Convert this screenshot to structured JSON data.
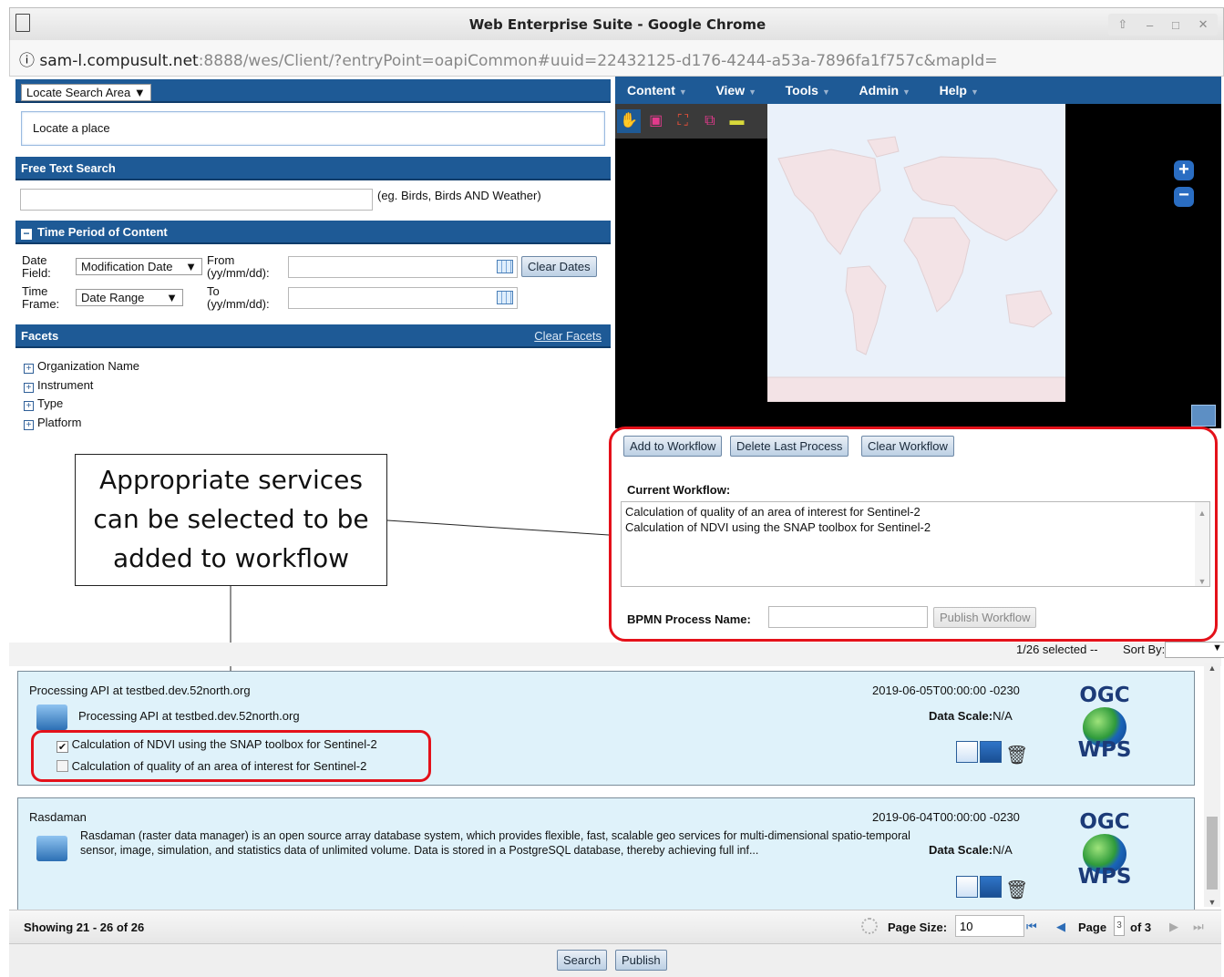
{
  "window": {
    "title": "Web Enterprise Suite - Google Chrome",
    "controls": [
      "⇧",
      "–",
      "□",
      "✕"
    ]
  },
  "address_bar": {
    "info_icon": "ⓘ",
    "host": "sam-l.compusult.net",
    "rest": ":8888/wes/Client/?entryPoint=oapiCommon#uuid=22432125-d176-4244-a53a-7896fa1f757c&mapId="
  },
  "left_panel": {
    "locate_dropdown": "Locate Search Area",
    "locate_placeholder": "Locate a place",
    "free_text_header": "Free Text Search",
    "free_text_hint": "(eg. Birds, Birds AND Weather)",
    "time_header": "Time Period of Content",
    "date_field_label": "Date Field:",
    "date_field_value": "Modification Date",
    "from_label": "From (yy/mm/dd):",
    "clear_dates": "Clear Dates",
    "time_frame_label": "Time Frame:",
    "time_frame_value": "Date Range",
    "to_label": "To (yy/mm/dd):",
    "facets_header": "Facets",
    "clear_facets": "Clear Facets",
    "facets": [
      "Organization Name",
      "Instrument",
      "Type",
      "Platform"
    ]
  },
  "map_menu": [
    "Content",
    "View",
    "Tools",
    "Admin",
    "Help"
  ],
  "workflow": {
    "add": "Add to Workflow",
    "delete_last": "Delete Last Process",
    "clear": "Clear Workflow",
    "current_label": "Current Workflow:",
    "items": [
      "Calculation of quality of an area of interest for Sentinel-2",
      "Calculation of NDVI using the SNAP toolbox for Sentinel-2"
    ],
    "bpmn_label": "BPMN Process Name:",
    "publish": "Publish Workflow"
  },
  "callout": {
    "line1": "Appropriate services",
    "line2": "can be selected to be",
    "line3": "added to workflow"
  },
  "results": {
    "selection": "1/26 selected --",
    "sort_label": "Sort By:",
    "items": [
      {
        "title": "Processing API at testbed.dev.52north.org",
        "date": "2019-06-05T00:00:00 -0230",
        "description": "Processing API at testbed.dev.52north.org",
        "scale_label": "Data Scale:",
        "scale_value": "N/A",
        "logo_top": "OGC",
        "logo_bottom": "WPS",
        "processes": [
          {
            "label": "Calculation of NDVI using the SNAP toolbox for Sentinel-2",
            "checked": true
          },
          {
            "label": "Calculation of quality of an area of interest for Sentinel-2",
            "checked": false
          }
        ]
      },
      {
        "title": "Rasdaman",
        "date": "2019-06-04T00:00:00 -0230",
        "description": "Rasdaman (raster data manager) is an open source array database system, which provides flexible, fast, scalable geo services for multi-dimensional spatio-temporal sensor, image, simulation, and statistics data of unlimited volume. Data is stored in a PostgreSQL database, thereby achieving full inf...",
        "scale_label": "Data Scale:",
        "scale_value": "N/A",
        "logo_top": "OGC",
        "logo_bottom": "WPS"
      }
    ]
  },
  "pager": {
    "showing": "Showing 21 - 26 of 26",
    "page_size_label": "Page Size:",
    "page_size_value": "10",
    "page_label": "Page",
    "page_value": "3",
    "of_label": "of 3"
  },
  "footer": {
    "search": "Search",
    "publish": "Publish"
  },
  "colors": {
    "panel_header": "#1e5a96",
    "highlight_red": "#e4111a",
    "result_bg": "#dff2fa",
    "map_bg": "#000000",
    "map_land": "#f3e3e6"
  }
}
